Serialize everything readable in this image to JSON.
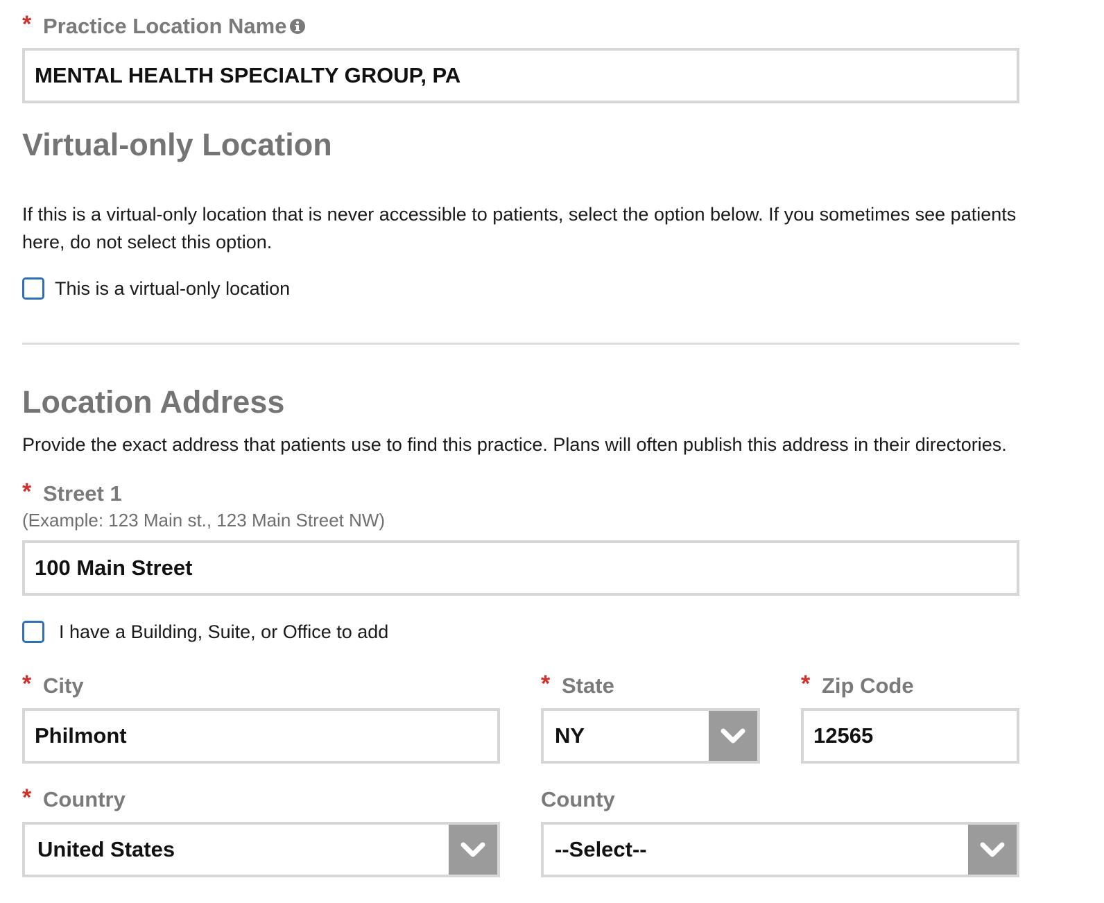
{
  "practice_location": {
    "label": "Practice Location Name",
    "value": "MENTAL HEALTH SPECIALTY GROUP, PA"
  },
  "virtual_section": {
    "heading": "Virtual-only Location",
    "description": "If this is a virtual-only location that is never accessible to patients, select the option below. If you sometimes see patients here, do not select this option.",
    "checkbox_label": "This is a virtual-only location",
    "checked": false
  },
  "address_section": {
    "heading": "Location Address",
    "description": "Provide the exact address that patients use to find this practice. Plans will often publish this address in their directories.",
    "street1": {
      "label": "Street 1",
      "hint": "(Example: 123 Main st., 123 Main Street NW)",
      "value": "100 Main Street"
    },
    "suite_checkbox": {
      "label": "I have a Building, Suite, or Office to add",
      "checked": false
    },
    "city": {
      "label": "City",
      "value": "Philmont"
    },
    "state": {
      "label": "State",
      "value": "NY"
    },
    "zip": {
      "label": "Zip Code",
      "value": "12565"
    },
    "country": {
      "label": "Country",
      "value": "United States"
    },
    "county": {
      "label": "County",
      "value": "--Select--"
    }
  },
  "colors": {
    "required_asterisk": "#d0312d",
    "label_gray": "#7a7a7a",
    "checkbox_blue": "#2f6fb8",
    "select_arrow_bg": "#9b9b9b",
    "input_border": "#d6d6d6"
  }
}
